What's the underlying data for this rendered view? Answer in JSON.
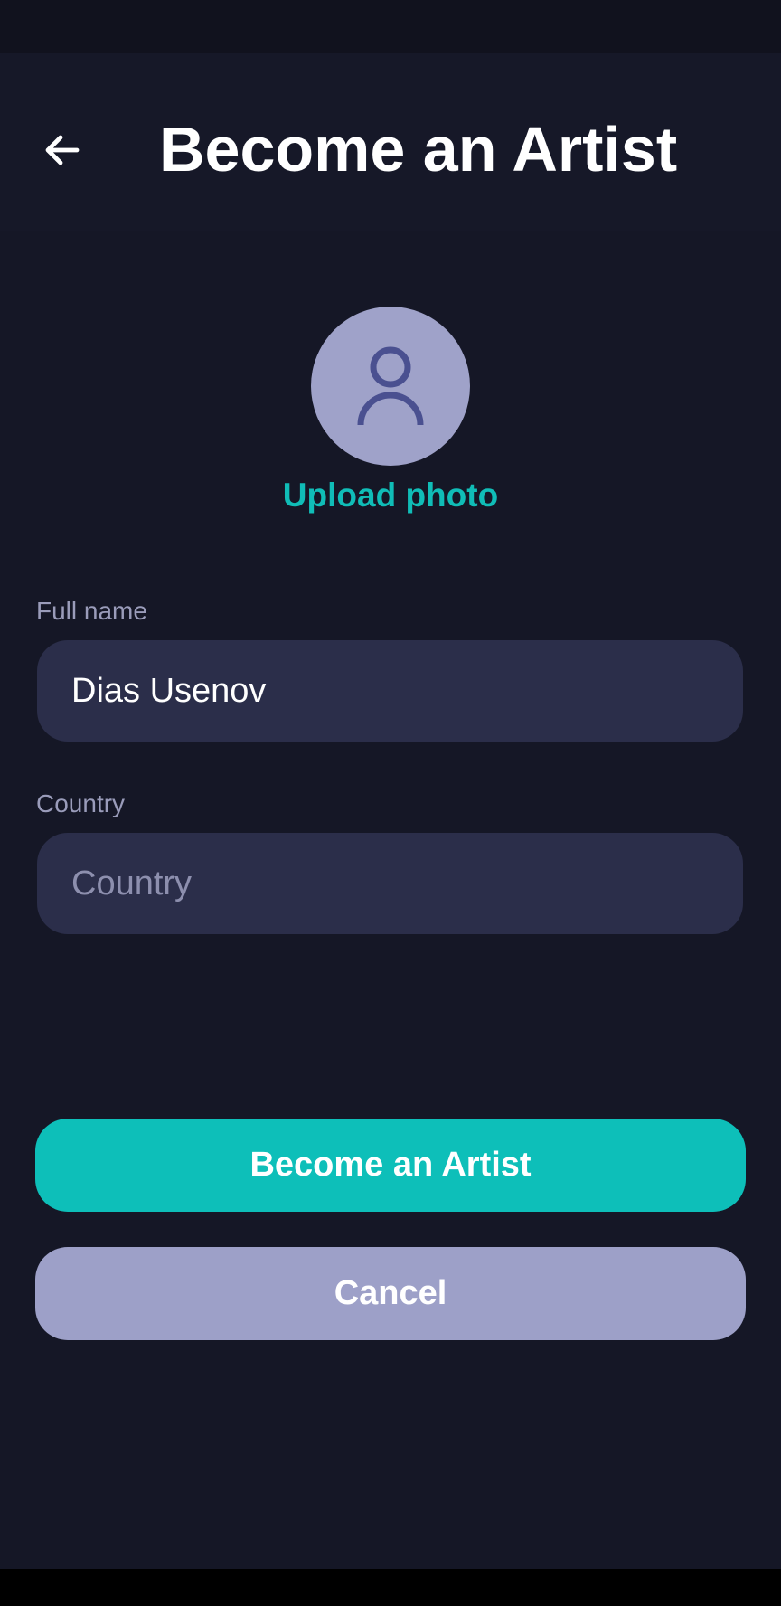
{
  "header": {
    "title": "Become an Artist",
    "back_icon": "arrow-left-icon"
  },
  "avatar": {
    "icon": "person-icon",
    "upload_label": "Upload photo"
  },
  "form": {
    "full_name": {
      "label": "Full name",
      "value": "Dias Usenov",
      "placeholder": "Full name"
    },
    "country": {
      "label": "Country",
      "value": "",
      "placeholder": "Country"
    }
  },
  "actions": {
    "primary_label": "Become an Artist",
    "secondary_label": "Cancel"
  },
  "colors": {
    "background": "#151726",
    "field_background": "#2b2e4a",
    "accent": "#0dbfb9",
    "secondary": "#9da0c8"
  }
}
